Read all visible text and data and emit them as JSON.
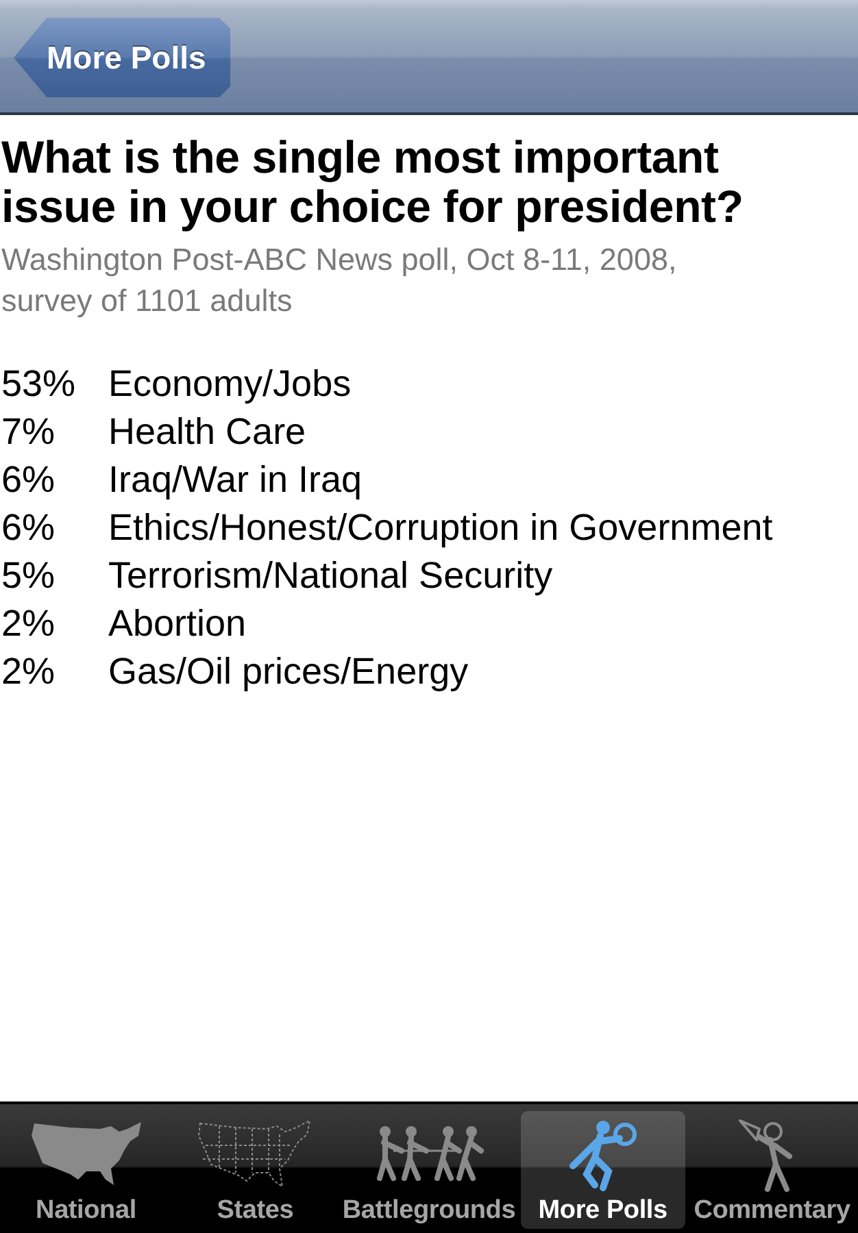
{
  "nav_bar": {
    "back_button": "More Polls"
  },
  "question": {
    "title": "What is the single most important issue in your choice for president?",
    "source": "Washington Post-ABC News poll, Oct 8-11, 2008, survey of 1101 adults"
  },
  "results": [
    {
      "percent": "53%",
      "issue": "Economy/Jobs"
    },
    {
      "percent": "7%",
      "issue": "Health Care"
    },
    {
      "percent": "6%",
      "issue": "Iraq/War in Iraq"
    },
    {
      "percent": "6%",
      "issue": "Ethics/Honest/Corruption in Government"
    },
    {
      "percent": "5%",
      "issue": "Terrorism/National Security"
    },
    {
      "percent": "2%",
      "issue": "Abortion"
    },
    {
      "percent": "2%",
      "issue": "Gas/Oil prices/Energy"
    }
  ],
  "tab_bar": [
    {
      "label": "National",
      "kind": "usmap",
      "selected": false
    },
    {
      "label": "States",
      "kind": "statesmap",
      "selected": false
    },
    {
      "label": "Battlegrounds",
      "kind": "tugofwar",
      "selected": false
    },
    {
      "label": "More Polls",
      "kind": "magnifier",
      "selected": true
    },
    {
      "label": "Commentary",
      "kind": "megaphone",
      "selected": false
    }
  ]
}
